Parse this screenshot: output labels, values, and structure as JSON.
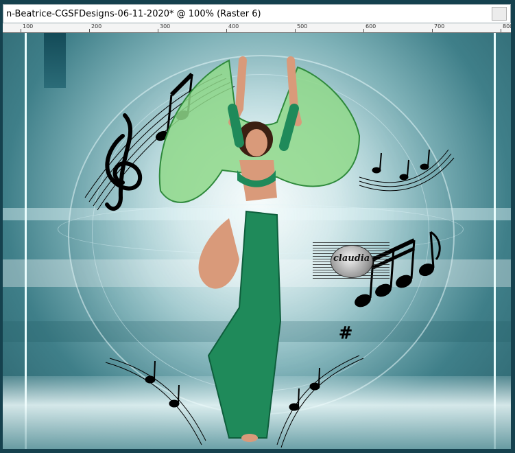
{
  "window": {
    "title": "n-Beatrice-CGSFDesigns-06-11-2020* @ 100% (Raster 6)"
  },
  "ruler": {
    "labels": [
      "100",
      "200",
      "300",
      "400",
      "500",
      "600",
      "700",
      "800"
    ]
  },
  "canvas": {
    "watermark_text": "claudia",
    "colors": {
      "teal_dark": "#1a4f5e",
      "dress_green": "#1f8a5a",
      "scarf_green": "#7fcf7a",
      "skin": "#d99a7a"
    }
  },
  "icons": {
    "treble_clef": "treble-clef-icon",
    "music_notes": "music-notes-icon"
  }
}
